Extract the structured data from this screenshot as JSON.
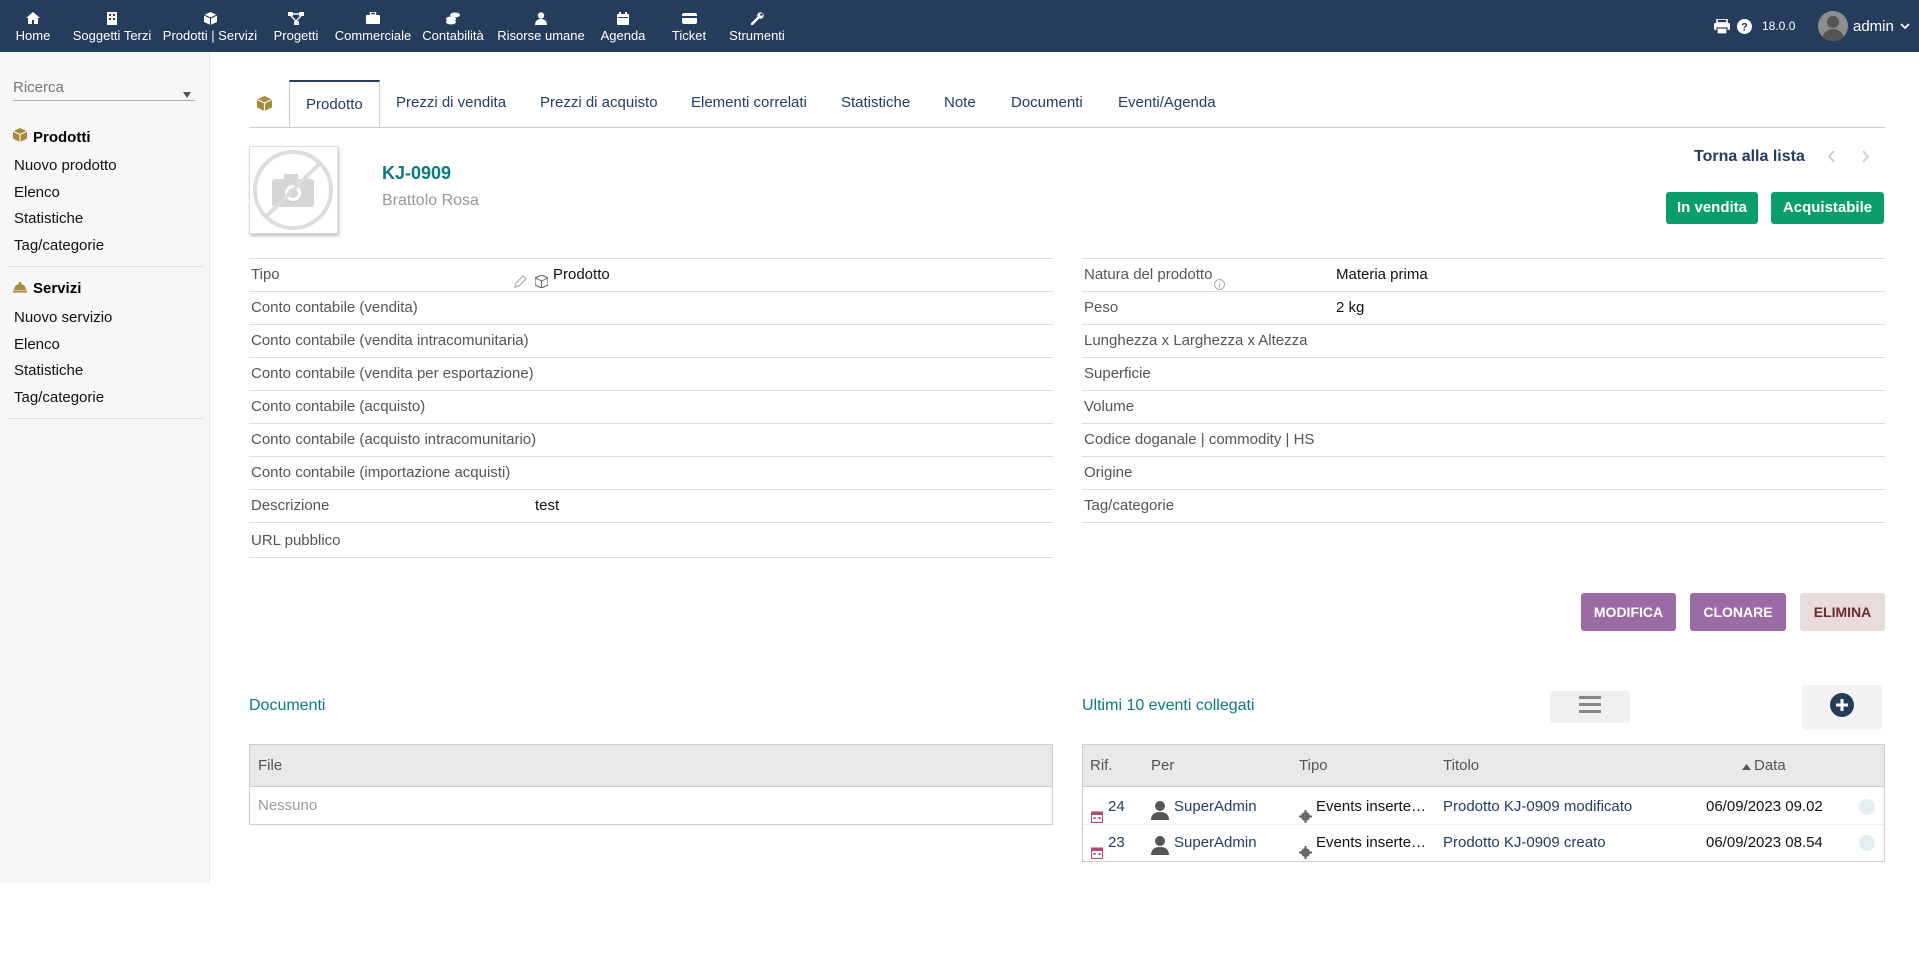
{
  "topnav": [
    {
      "key": "home",
      "label": "Home",
      "icon": "home-icon"
    },
    {
      "key": "soggetti",
      "label": "Soggetti Terzi",
      "icon": "building-icon"
    },
    {
      "key": "prodotti",
      "label": "Prodotti | Servizi",
      "icon": "cube-icon"
    },
    {
      "key": "progetti",
      "label": "Progetti",
      "icon": "sitemap-icon"
    },
    {
      "key": "commerciale",
      "label": "Commerciale",
      "icon": "briefcase-icon"
    },
    {
      "key": "contabilita",
      "label": "Contabilità",
      "icon": "coins-icon"
    },
    {
      "key": "risorse",
      "label": "Risorse umane",
      "icon": "user-icon"
    },
    {
      "key": "agenda",
      "label": "Agenda",
      "icon": "calendar-icon"
    },
    {
      "key": "ticket",
      "label": "Ticket",
      "icon": "ticket-icon"
    },
    {
      "key": "strumenti",
      "label": "Strumenti",
      "icon": "wrench-icon"
    }
  ],
  "topright": {
    "version": "18.0.0",
    "user": "admin"
  },
  "sidebar": {
    "search_placeholder": "Ricerca",
    "groups": [
      {
        "title": "Prodotti",
        "icon": "cube-icon",
        "items": [
          "Nuovo prodotto",
          "Elenco",
          "Statistiche",
          "Tag/categorie"
        ]
      },
      {
        "title": "Servizi",
        "icon": "bell-icon",
        "items": [
          "Nuovo servizio",
          "Elenco",
          "Statistiche",
          "Tag/categorie"
        ]
      }
    ]
  },
  "tabs": [
    "Prodotto",
    "Prezzi di vendita",
    "Prezzi di acquisto",
    "Elementi correlati",
    "Statistiche",
    "Note",
    "Documenti",
    "Eventi/Agenda"
  ],
  "product": {
    "ref": "KJ-0909",
    "label": "Brattolo Rosa",
    "back_link": "Torna alla lista",
    "status_sell": "In vendita",
    "status_buy": "Acquistabile"
  },
  "left_fields": [
    {
      "label": "Tipo",
      "value": "Prodotto"
    },
    {
      "label": "Conto contabile (vendita)",
      "value": ""
    },
    {
      "label": "Conto contabile (vendita intracomunitaria)",
      "value": ""
    },
    {
      "label": "Conto contabile (vendita per esportazione)",
      "value": ""
    },
    {
      "label": "Conto contabile (acquisto)",
      "value": ""
    },
    {
      "label": "Conto contabile (acquisto intracomunitario)",
      "value": ""
    },
    {
      "label": "Conto contabile (importazione acquisti)",
      "value": ""
    },
    {
      "label": "Descrizione",
      "value": "test"
    },
    {
      "label": "URL pubblico",
      "value": ""
    }
  ],
  "right_fields": [
    {
      "label": "Natura del prodotto",
      "value": "Materia prima"
    },
    {
      "label": "Peso",
      "value": "2 kg"
    },
    {
      "label": "Lunghezza x Larghezza x Altezza",
      "value": ""
    },
    {
      "label": "Superficie",
      "value": ""
    },
    {
      "label": "Volume",
      "value": ""
    },
    {
      "label": "Codice doganale | commodity | HS",
      "value": ""
    },
    {
      "label": "Origine",
      "value": ""
    },
    {
      "label": "Tag/categorie",
      "value": ""
    }
  ],
  "actions": {
    "modify": "MODIFICA",
    "clone": "CLONARE",
    "delete": "ELIMINA"
  },
  "documents": {
    "title": "Documenti",
    "col_file": "File",
    "empty": "Nessuno"
  },
  "events": {
    "title": "Ultimi 10 eventi collegati",
    "columns": [
      "Rif.",
      "Per",
      "Tipo",
      "Titolo",
      "Data"
    ],
    "rows": [
      {
        "ref": "24",
        "user": "SuperAdmin",
        "type": "Events inserte…",
        "title": "Prodotto KJ-0909 modificato",
        "date": "06/09/2023 09.02"
      },
      {
        "ref": "23",
        "user": "SuperAdmin",
        "type": "Events inserte…",
        "title": "Prodotto KJ-0909 creato",
        "date": "06/09/2023 08.54"
      }
    ]
  },
  "colors": {
    "topbar": "#263c5c",
    "green": "#0b9e6c",
    "purple": "#9c6aa4",
    "teal": "#0b7a83"
  }
}
